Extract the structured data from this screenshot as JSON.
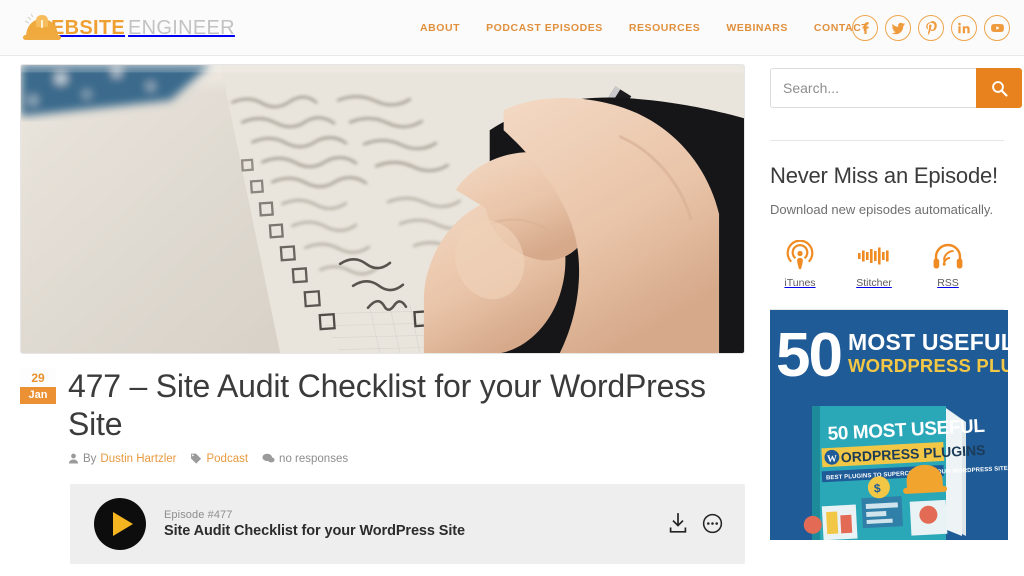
{
  "header": {
    "logo": {
      "part1": "EBSITE",
      "part2": "ENGINEER",
      "icon": "hard-hat-icon"
    },
    "nav": [
      {
        "label": "ABOUT"
      },
      {
        "label": "PODCAST EPISODES"
      },
      {
        "label": "RESOURCES"
      },
      {
        "label": "WEBINARS"
      },
      {
        "label": "CONTACT"
      }
    ],
    "social": [
      {
        "name": "facebook-icon",
        "title": "Facebook"
      },
      {
        "name": "twitter-icon",
        "title": "Twitter"
      },
      {
        "name": "pinterest-icon",
        "title": "Pinterest"
      },
      {
        "name": "linkedin-icon",
        "title": "LinkedIn"
      },
      {
        "name": "youtube-icon",
        "title": "YouTube"
      }
    ]
  },
  "hero": {
    "alt": "Hand writing a checklist in a grid notebook with a pen"
  },
  "post": {
    "date": {
      "day": "29",
      "month": "Jan"
    },
    "title": "477 – Site Audit Checklist for your WordPress Site",
    "meta": {
      "by_label": "By",
      "author": "Dustin Hartzler",
      "category": "Podcast",
      "responses": "no responses"
    },
    "player": {
      "episode_label": "Episode #477",
      "episode_title": "Site Audit Checklist for your WordPress Site",
      "play_icon": "play-icon",
      "download_icon": "download-icon",
      "more_icon": "more-options-icon"
    }
  },
  "sidebar": {
    "search": {
      "placeholder": "Search...",
      "value": "",
      "button_icon": "search-icon"
    },
    "subscribe": {
      "title": "Never Miss an Episode!",
      "subtitle": "Download new episodes automatically.",
      "services": [
        {
          "label": "iTunes",
          "icon": "podcast-antenna-icon"
        },
        {
          "label": "Stitcher",
          "icon": "stitcher-waveform-icon"
        },
        {
          "label": "RSS",
          "icon": "rss-headphones-icon"
        }
      ]
    },
    "promo": {
      "headline_number": "50",
      "headline_line1": "MOST USEFUL",
      "headline_line2": "WORDPRESS PLUGINS",
      "book_line1": "50 MOST USEFUL",
      "book_line2": "ORDPRESS PLUGINS",
      "book_line3": "BEST PLUGINS TO SUPERCHARGE YOUR WORDPRESS SITE"
    }
  },
  "colors": {
    "brand_orange": "#e8821e",
    "nav_orange": "#e0903c",
    "logo_orange": "#efa033",
    "promo_blue": "#1f5b96",
    "promo_gold": "#f2c745",
    "play_yellow": "#f5b521",
    "text_dark": "#3b3b3b",
    "text_muted": "#8d8d8d"
  }
}
